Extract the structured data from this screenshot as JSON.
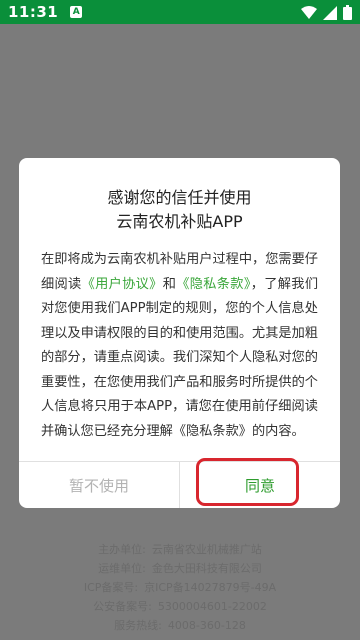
{
  "status_bar": {
    "time": "11:31",
    "app_badge": "A",
    "icons": [
      "wifi-icon",
      "signal-icon",
      "battery-icon"
    ]
  },
  "dialog": {
    "title_line1": "感谢您的信任并使用",
    "title_line2": "云南农机补贴APP",
    "body_prefix": "在即将成为云南农机补贴用户过程中，您需要仔细阅读",
    "user_agreement_link": "《用户协议》",
    "and_text": "和",
    "privacy_link": "《隐私条款》",
    "body_rest": "，了解我们对您使用我们APP制定的规则，您的个人信息处理以及申请权限的目的和使用范围。尤其是加粗的部分，请重点阅读。我们深知个人隐私对您的重要性，在您使用我们产品和服务时所提供的个人信息将只用于本APP，请您在使用前仔细阅读并确认您已经充分理解《隐私条款》的内容。",
    "decline_label": "暂不使用",
    "agree_label": "同意"
  },
  "footer": {
    "rows": [
      {
        "label": "主办单位:",
        "value": "云南省农业机械推广站"
      },
      {
        "label": "运维单位:",
        "value": "金色大田科技有限公司"
      },
      {
        "label": "ICP备案号:",
        "value": "京ICP备14027879号-49A"
      },
      {
        "label": "公安备案号:",
        "value": "5300004601-22002"
      },
      {
        "label": "服务热线:",
        "value": "4008-360-128"
      }
    ]
  },
  "colors": {
    "status_bar": "#0a8f3a",
    "link": "#3aa63a",
    "agree": "#2e9c2e",
    "highlight": "#d8262e"
  }
}
